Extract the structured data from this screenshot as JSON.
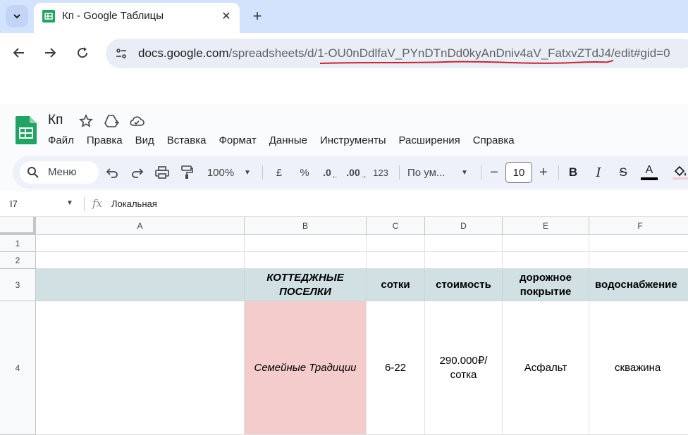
{
  "browser": {
    "tab_title": "Кп - Google Таблицы",
    "url_host": "docs.google.com",
    "url_path": "/spreadsheets/d/1-OU0nDdlfaV_PYnDTnDd0kyAnDniv4aV_FatxvZTdJ4/edit#gid=0",
    "annotation_color": "#d0202c"
  },
  "sheets": {
    "doc_title": "Кп",
    "brand_color": "#1fa463",
    "menu": [
      "Файл",
      "Правка",
      "Вид",
      "Вставка",
      "Формат",
      "Данные",
      "Инструменты",
      "Расширения",
      "Справка"
    ],
    "toolbar": {
      "search_label": "Меню",
      "zoom": "100%",
      "currency": "£",
      "percent": "%",
      "decrease_decimals": ".0",
      "increase_decimals": ".00",
      "number_format": "123",
      "font": "По ум...",
      "font_size": "10",
      "bold": "B",
      "italic": "I",
      "strike": "S",
      "text_color": "A"
    },
    "formula_bar": {
      "name_box": "I7",
      "fx": "fx",
      "value": "Локальная"
    },
    "columns": [
      "A",
      "B",
      "C",
      "D",
      "E",
      "F"
    ],
    "rows": [
      "1",
      "2",
      "3",
      "4"
    ],
    "header_row": {
      "b": "КОТТЕДЖНЫЕ ПОСЕЛКИ",
      "c": "сотки",
      "d": "стоимость",
      "e": "дорожное покрытие",
      "f": "водоснабжение"
    },
    "data_row": {
      "b": "Семейные Традиции",
      "c": "6-22",
      "d": "290.000₽/ сотка",
      "e": "Асфальт",
      "f": "скважина"
    },
    "colors": {
      "header_fill": "#d0e0e3",
      "highlight_fill": "#f4cccc"
    }
  }
}
